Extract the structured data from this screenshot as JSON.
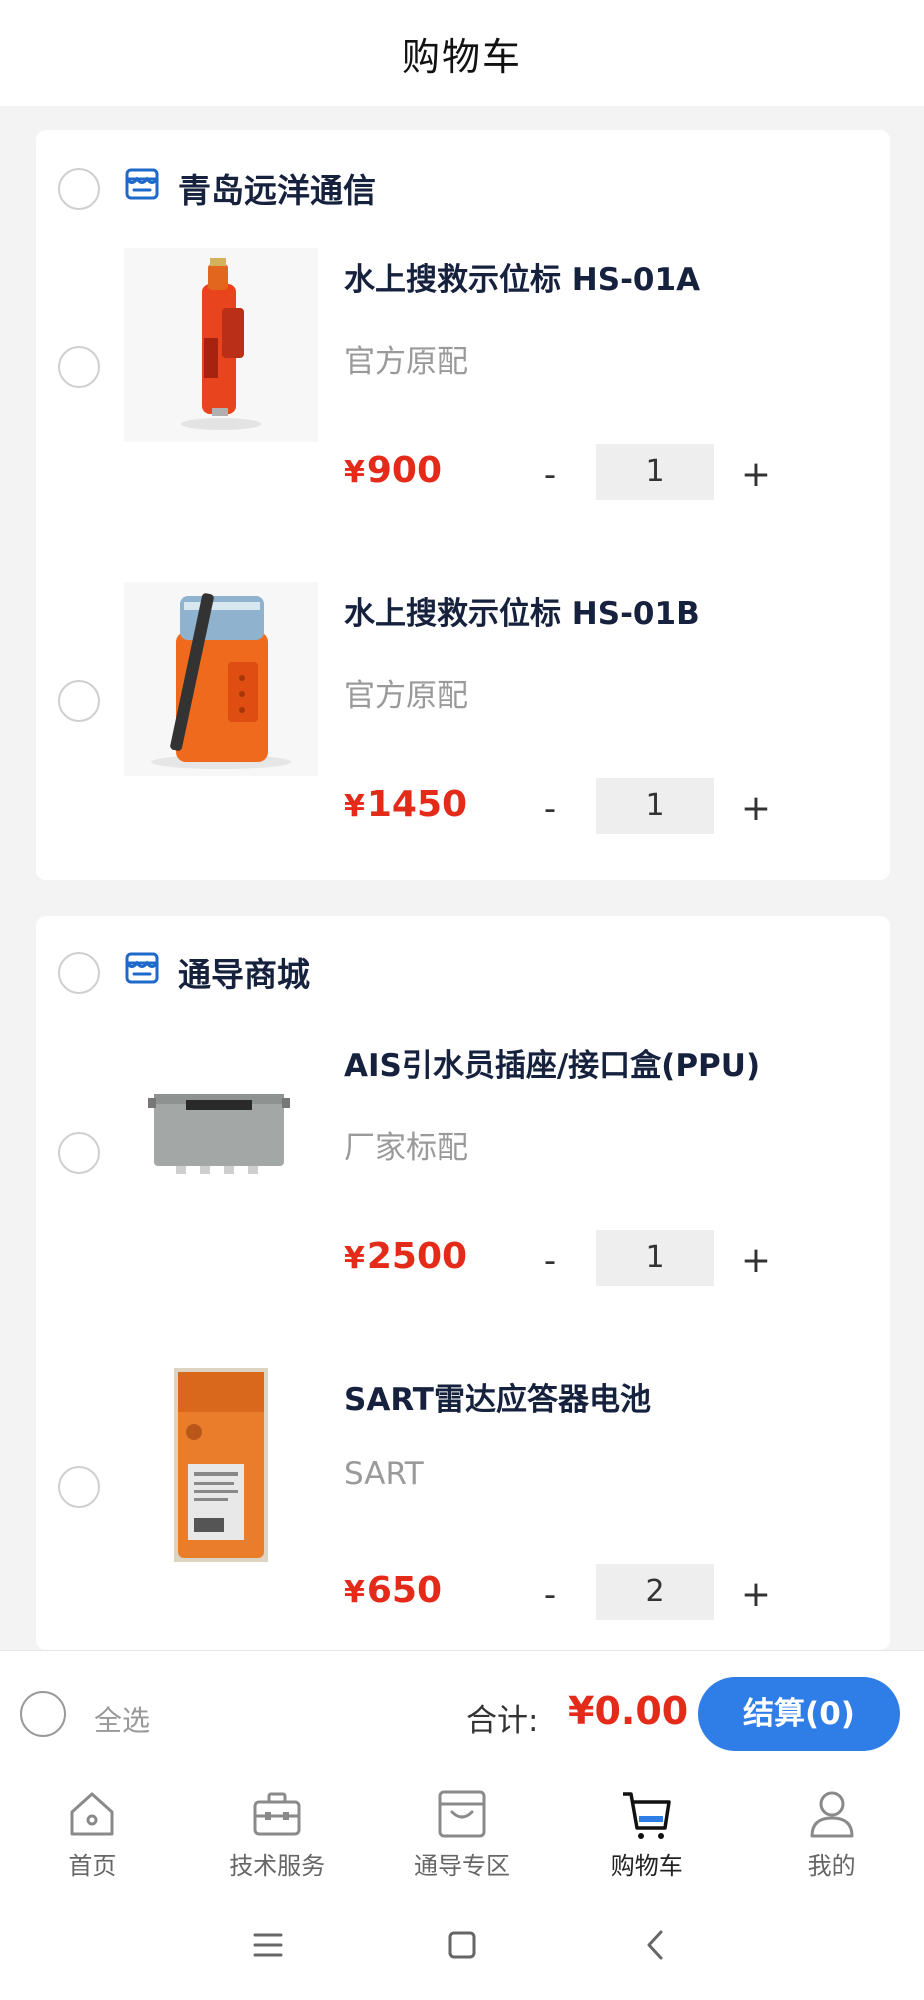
{
  "header": {
    "title": "购物车"
  },
  "shops": [
    {
      "name": "青岛远洋通信",
      "items": [
        {
          "name": "水上搜救示位标 HS-01A",
          "spec": "官方原配",
          "currency": "¥",
          "price": "900",
          "qty": "1",
          "minus": "-",
          "plus": "+"
        },
        {
          "name": "水上搜救示位标 HS-01B",
          "spec": "官方原配",
          "currency": "¥",
          "price": "1450",
          "qty": "1",
          "minus": "-",
          "plus": "+"
        }
      ]
    },
    {
      "name": "通导商城",
      "items": [
        {
          "name": "AIS引水员插座/接口盒(PPU)",
          "spec": "厂家标配",
          "currency": "¥",
          "price": "2500",
          "qty": "1",
          "minus": "-",
          "plus": "+"
        },
        {
          "name": "SART雷达应答器电池",
          "spec": "SART",
          "currency": "¥",
          "price": "650",
          "qty": "2",
          "minus": "-",
          "plus": "+"
        }
      ]
    }
  ],
  "checkout": {
    "select_all": "全选",
    "total_label": "合计:",
    "total_value": "¥0.00",
    "button": "结算(0)"
  },
  "tabs": [
    {
      "label": "首页",
      "icon": "home-icon"
    },
    {
      "label": "技术服务",
      "icon": "toolbox-icon"
    },
    {
      "label": "通导专区",
      "icon": "shop-box-icon"
    },
    {
      "label": "购物车",
      "icon": "cart-icon",
      "active": true
    },
    {
      "label": "我的",
      "icon": "user-icon"
    }
  ],
  "colors": {
    "accent": "#2f7ee8",
    "price": "#e42b1a",
    "shop_icon": "#1d68c9"
  }
}
